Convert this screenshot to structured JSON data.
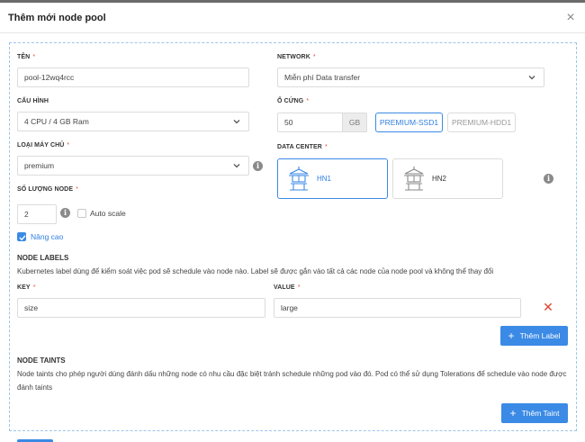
{
  "modal": {
    "title": "Thêm mới node pool",
    "close_symbol": "×"
  },
  "fields": {
    "name": {
      "label": "TÊN",
      "required": "*",
      "value": "pool-12wq4rcc"
    },
    "network": {
      "label": "NETWORK",
      "required": "*",
      "value": "Miễn phí Data transfer"
    },
    "config": {
      "label": "CẤU HÌNH",
      "value": "4 CPU / 4 GB Ram"
    },
    "disk": {
      "label": "Ổ CỨNG",
      "required": "*",
      "value": "50",
      "unit": "GB",
      "options": [
        "PREMIUM-SSD1",
        "PREMIUM-HDD1"
      ],
      "selected": "PREMIUM-SSD1"
    },
    "server_type": {
      "label": "LOẠI MÁY CHỦ",
      "required": "*",
      "value": "premium"
    },
    "datacenter": {
      "label": "DATA CENTER",
      "required": "*",
      "options": [
        "HN1",
        "HN2"
      ],
      "selected": "HN1"
    },
    "node_count": {
      "label": "SỐ LƯỢNG NODE",
      "required": "*",
      "value": "2"
    },
    "auto_scale": {
      "label": "Auto scale",
      "checked": false
    },
    "advanced": {
      "label": "Nâng cao",
      "checked": true
    }
  },
  "node_labels": {
    "title": "NODE LABELS",
    "description": "Kubernetes label dùng để kiểm soát việc pod sẽ schedule vào node nào. Label sẽ được gắn vào tất cả các node của node pool và không thể thay đổi",
    "key_label": "KEY",
    "value_label": "VALUE",
    "required": "*",
    "rows": [
      {
        "key": "size",
        "value": "large"
      }
    ],
    "delete_symbol": "✕",
    "add_button": "Thêm Label"
  },
  "node_taints": {
    "title": "NODE TAINTS",
    "description": "Node taints cho phép người dùng đánh dấu những node có nhu cầu đặc biệt tránh schedule những pod vào đó. Pod có thể sử dụng Tolerations để schedule vào node được đánh taints",
    "add_button": "Thêm Taint"
  },
  "icons": {
    "info": "info-icon",
    "close": "close-icon",
    "datacenter": "temple-datacenter-icon",
    "chevron": "chevron-down-icon",
    "plus": "plus-icon",
    "check": "check-icon"
  },
  "colors": {
    "accent": "#3b8ae6",
    "danger": "#e0442e",
    "required": "#e74c3c"
  }
}
